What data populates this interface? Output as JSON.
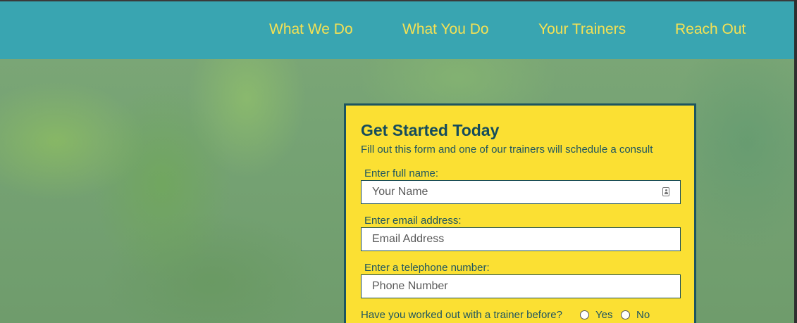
{
  "nav": {
    "items": [
      {
        "label": "What We Do"
      },
      {
        "label": "What You Do"
      },
      {
        "label": "Your Trainers"
      },
      {
        "label": "Reach Out"
      }
    ]
  },
  "form": {
    "title": "Get Started Today",
    "subtitle": "Fill out this form and one of our trainers will schedule a consult",
    "fields": {
      "name": {
        "label": "Enter full name:",
        "placeholder": "Your Name",
        "value": ""
      },
      "email": {
        "label": "Enter email address:",
        "placeholder": "Email Address",
        "value": ""
      },
      "phone": {
        "label": "Enter a telephone number:",
        "placeholder": "Phone Number",
        "value": ""
      }
    },
    "trainer_question": {
      "label": "Have you worked out with a trainer before?",
      "options": [
        {
          "label": "Yes",
          "selected": false
        },
        {
          "label": "No",
          "selected": false
        }
      ]
    }
  },
  "colors": {
    "header_bg": "#39a5b1",
    "nav_text": "#f5e153",
    "form_bg": "#fbe033",
    "form_border": "#1d5560",
    "form_title": "#154c5c"
  }
}
